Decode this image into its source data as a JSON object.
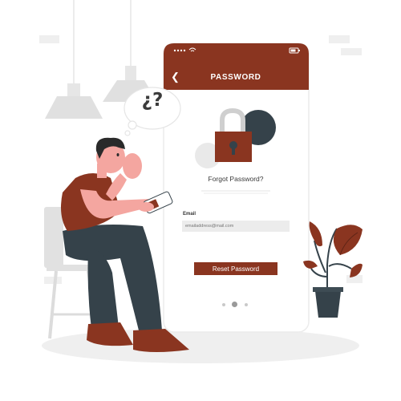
{
  "phone": {
    "title": "PASSWORD",
    "heading": "Forgot Password?",
    "email_label": "Email",
    "email_placeholder": "emailaddress@mail.com",
    "reset_button": "Reset Password",
    "pagination": {
      "count": 3,
      "active": 2
    }
  },
  "thought_bubble": {
    "text": "¿?"
  },
  "colors": {
    "accent": "#8a3520",
    "dark": "#2f3b40",
    "skin": "#f4a6a0",
    "light": "#f2f2f2"
  },
  "icons": [
    "back-arrow-icon",
    "signal-icon",
    "wifi-icon",
    "battery-icon",
    "padlock-icon",
    "plant-icon",
    "lamp-icon"
  ]
}
